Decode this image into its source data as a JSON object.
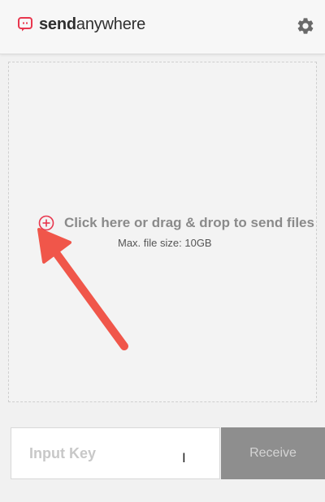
{
  "app": {
    "brand_primary": "send",
    "brand_secondary": "anywhere",
    "logo_icon": "sendanywhere-logo-icon",
    "settings_icon": "gear-icon"
  },
  "dropzone": {
    "label": "Click here or drag & drop to send files",
    "sublabel": "Max. file size: 10GB",
    "add_icon": "plus-circle-icon"
  },
  "receive": {
    "input_placeholder": "Input Key",
    "input_value": "",
    "button_label": "Receive"
  },
  "colors": {
    "accent": "#e8374e",
    "header_bg": "#f7f7f7",
    "page_bg": "#f1f1f1",
    "receive_button_bg": "#8e8e8e",
    "annotation_arrow": "#f0564a"
  }
}
